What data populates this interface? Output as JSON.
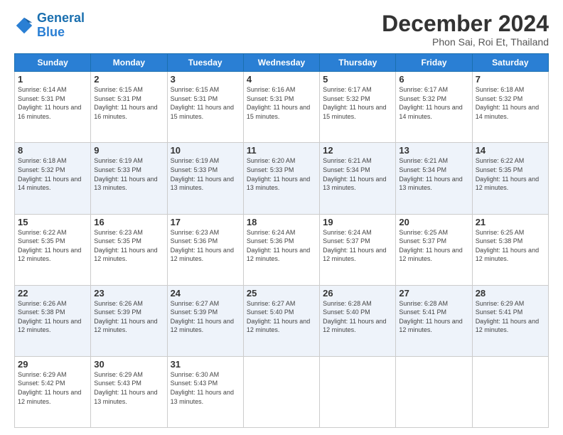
{
  "header": {
    "logo_line1": "General",
    "logo_line2": "Blue",
    "month": "December 2024",
    "location": "Phon Sai, Roi Et, Thailand"
  },
  "days_of_week": [
    "Sunday",
    "Monday",
    "Tuesday",
    "Wednesday",
    "Thursday",
    "Friday",
    "Saturday"
  ],
  "weeks": [
    [
      {
        "day": "1",
        "sunrise": "6:14 AM",
        "sunset": "5:31 PM",
        "daylight": "11 hours and 16 minutes."
      },
      {
        "day": "2",
        "sunrise": "6:15 AM",
        "sunset": "5:31 PM",
        "daylight": "11 hours and 16 minutes."
      },
      {
        "day": "3",
        "sunrise": "6:15 AM",
        "sunset": "5:31 PM",
        "daylight": "11 hours and 15 minutes."
      },
      {
        "day": "4",
        "sunrise": "6:16 AM",
        "sunset": "5:31 PM",
        "daylight": "11 hours and 15 minutes."
      },
      {
        "day": "5",
        "sunrise": "6:17 AM",
        "sunset": "5:32 PM",
        "daylight": "11 hours and 15 minutes."
      },
      {
        "day": "6",
        "sunrise": "6:17 AM",
        "sunset": "5:32 PM",
        "daylight": "11 hours and 14 minutes."
      },
      {
        "day": "7",
        "sunrise": "6:18 AM",
        "sunset": "5:32 PM",
        "daylight": "11 hours and 14 minutes."
      }
    ],
    [
      {
        "day": "8",
        "sunrise": "6:18 AM",
        "sunset": "5:32 PM",
        "daylight": "11 hours and 14 minutes."
      },
      {
        "day": "9",
        "sunrise": "6:19 AM",
        "sunset": "5:33 PM",
        "daylight": "11 hours and 13 minutes."
      },
      {
        "day": "10",
        "sunrise": "6:19 AM",
        "sunset": "5:33 PM",
        "daylight": "11 hours and 13 minutes."
      },
      {
        "day": "11",
        "sunrise": "6:20 AM",
        "sunset": "5:33 PM",
        "daylight": "11 hours and 13 minutes."
      },
      {
        "day": "12",
        "sunrise": "6:21 AM",
        "sunset": "5:34 PM",
        "daylight": "11 hours and 13 minutes."
      },
      {
        "day": "13",
        "sunrise": "6:21 AM",
        "sunset": "5:34 PM",
        "daylight": "11 hours and 13 minutes."
      },
      {
        "day": "14",
        "sunrise": "6:22 AM",
        "sunset": "5:35 PM",
        "daylight": "11 hours and 12 minutes."
      }
    ],
    [
      {
        "day": "15",
        "sunrise": "6:22 AM",
        "sunset": "5:35 PM",
        "daylight": "11 hours and 12 minutes."
      },
      {
        "day": "16",
        "sunrise": "6:23 AM",
        "sunset": "5:35 PM",
        "daylight": "11 hours and 12 minutes."
      },
      {
        "day": "17",
        "sunrise": "6:23 AM",
        "sunset": "5:36 PM",
        "daylight": "11 hours and 12 minutes."
      },
      {
        "day": "18",
        "sunrise": "6:24 AM",
        "sunset": "5:36 PM",
        "daylight": "11 hours and 12 minutes."
      },
      {
        "day": "19",
        "sunrise": "6:24 AM",
        "sunset": "5:37 PM",
        "daylight": "11 hours and 12 minutes."
      },
      {
        "day": "20",
        "sunrise": "6:25 AM",
        "sunset": "5:37 PM",
        "daylight": "11 hours and 12 minutes."
      },
      {
        "day": "21",
        "sunrise": "6:25 AM",
        "sunset": "5:38 PM",
        "daylight": "11 hours and 12 minutes."
      }
    ],
    [
      {
        "day": "22",
        "sunrise": "6:26 AM",
        "sunset": "5:38 PM",
        "daylight": "11 hours and 12 minutes."
      },
      {
        "day": "23",
        "sunrise": "6:26 AM",
        "sunset": "5:39 PM",
        "daylight": "11 hours and 12 minutes."
      },
      {
        "day": "24",
        "sunrise": "6:27 AM",
        "sunset": "5:39 PM",
        "daylight": "11 hours and 12 minutes."
      },
      {
        "day": "25",
        "sunrise": "6:27 AM",
        "sunset": "5:40 PM",
        "daylight": "11 hours and 12 minutes."
      },
      {
        "day": "26",
        "sunrise": "6:28 AM",
        "sunset": "5:40 PM",
        "daylight": "11 hours and 12 minutes."
      },
      {
        "day": "27",
        "sunrise": "6:28 AM",
        "sunset": "5:41 PM",
        "daylight": "11 hours and 12 minutes."
      },
      {
        "day": "28",
        "sunrise": "6:29 AM",
        "sunset": "5:41 PM",
        "daylight": "11 hours and 12 minutes."
      }
    ],
    [
      {
        "day": "29",
        "sunrise": "6:29 AM",
        "sunset": "5:42 PM",
        "daylight": "11 hours and 12 minutes."
      },
      {
        "day": "30",
        "sunrise": "6:29 AM",
        "sunset": "5:43 PM",
        "daylight": "11 hours and 13 minutes."
      },
      {
        "day": "31",
        "sunrise": "6:30 AM",
        "sunset": "5:43 PM",
        "daylight": "11 hours and 13 minutes."
      },
      null,
      null,
      null,
      null
    ]
  ]
}
